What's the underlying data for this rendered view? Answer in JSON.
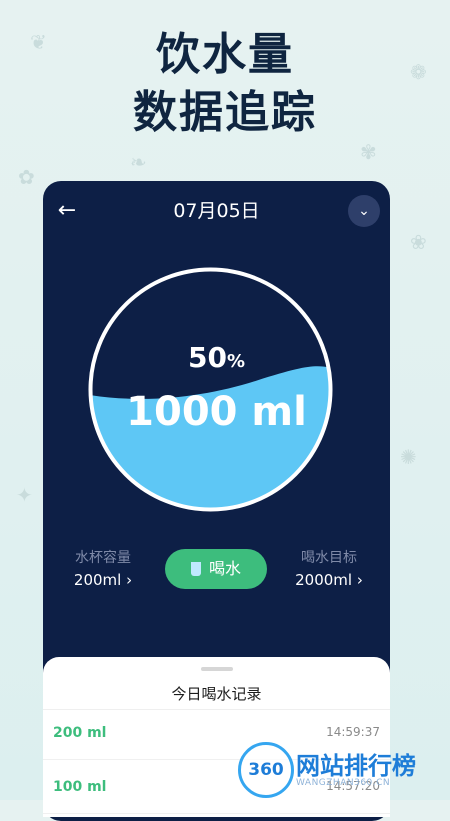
{
  "headline": {
    "line1": "饮水量",
    "line2": "数据追踪"
  },
  "header": {
    "date": "07月05日",
    "back_icon": "←",
    "dropdown_icon": "⌄"
  },
  "gauge": {
    "percent": "50",
    "percent_unit": "%",
    "amount": "1000 ml",
    "fill_fraction": 0.5,
    "water_color": "#5ec7f5"
  },
  "controls": {
    "cup_capacity_label": "水杯容量",
    "cup_capacity_value": "200ml  ›",
    "drink_button": "喝水",
    "goal_label": "喝水目标",
    "goal_value": "2000ml  ›"
  },
  "records": {
    "title": "今日喝水记录",
    "items": [
      {
        "amount": "200 ml",
        "time": "14:59:37"
      },
      {
        "amount": "100 ml",
        "time": "14:57:20"
      }
    ]
  },
  "watermark": {
    "mark": "360",
    "text": "网站排行榜",
    "url": "WANGZHAN360.CN"
  },
  "colors": {
    "accent_green": "#3dbd7d",
    "card_navy": "#0d1f46"
  }
}
